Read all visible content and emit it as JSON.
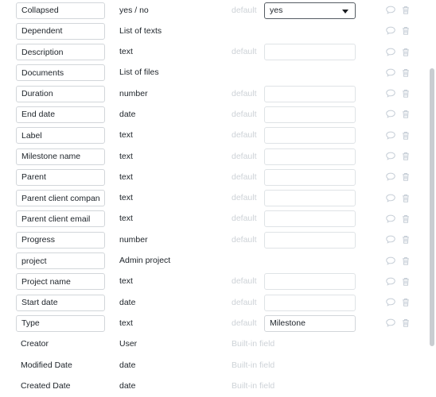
{
  "panel": {
    "default_label": "default",
    "builtin_label": "Built-in field",
    "comment_icon": "comment-icon",
    "delete_icon": "trash-icon",
    "caret_icon": "chevron-down-icon"
  },
  "colors": {
    "text": "#20262c",
    "muted": "#cdd2d7",
    "border": "#d2d6da",
    "border_light": "#dfe3e6",
    "icon": "#c5cdd6",
    "scrollbar": "#c9cdd1"
  },
  "fields": [
    {
      "name": "Collapsed",
      "type": "yes / no",
      "editable": true,
      "default_kind": "select",
      "default_label": "default",
      "default_value": "yes",
      "actions": true
    },
    {
      "name": "Dependent",
      "type": "List of texts",
      "editable": true,
      "default_kind": "none",
      "default_label": "",
      "default_value": "",
      "actions": true
    },
    {
      "name": "Description",
      "type": "text",
      "editable": true,
      "default_kind": "input",
      "default_label": "default",
      "default_value": "",
      "actions": true
    },
    {
      "name": "Documents",
      "type": "List of files",
      "editable": true,
      "default_kind": "none",
      "default_label": "",
      "default_value": "",
      "actions": true
    },
    {
      "name": "Duration",
      "type": "number",
      "editable": true,
      "default_kind": "input",
      "default_label": "default",
      "default_value": "",
      "actions": true
    },
    {
      "name": "End date",
      "type": "date",
      "editable": true,
      "default_kind": "input",
      "default_label": "default",
      "default_value": "",
      "actions": true
    },
    {
      "name": "Label",
      "type": "text",
      "editable": true,
      "default_kind": "input",
      "default_label": "default",
      "default_value": "",
      "actions": true
    },
    {
      "name": "Milestone name",
      "type": "text",
      "editable": true,
      "default_kind": "input",
      "default_label": "default",
      "default_value": "",
      "actions": true
    },
    {
      "name": "Parent",
      "type": "text",
      "editable": true,
      "default_kind": "input",
      "default_label": "default",
      "default_value": "",
      "actions": true
    },
    {
      "name": "Parent client company",
      "type": "text",
      "editable": true,
      "default_kind": "input",
      "default_label": "default",
      "default_value": "",
      "actions": true
    },
    {
      "name": "Parent client email",
      "type": "text",
      "editable": true,
      "default_kind": "input",
      "default_label": "default",
      "default_value": "",
      "actions": true
    },
    {
      "name": "Progress",
      "type": "number",
      "editable": true,
      "default_kind": "input",
      "default_label": "default",
      "default_value": "",
      "actions": true
    },
    {
      "name": "project",
      "type": "Admin project",
      "editable": true,
      "default_kind": "none",
      "default_label": "",
      "default_value": "",
      "actions": true
    },
    {
      "name": "Project name",
      "type": "text",
      "editable": true,
      "default_kind": "input",
      "default_label": "default",
      "default_value": "",
      "actions": true
    },
    {
      "name": "Start date",
      "type": "date",
      "editable": true,
      "default_kind": "input",
      "default_label": "default",
      "default_value": "",
      "actions": true
    },
    {
      "name": "Type",
      "type": "text",
      "editable": true,
      "default_kind": "input",
      "default_label": "default",
      "default_value": "Milestone",
      "actions": true
    },
    {
      "name": "Creator",
      "type": "User",
      "editable": false,
      "default_kind": "builtin",
      "default_label": "Built-in field",
      "default_value": "",
      "actions": false
    },
    {
      "name": "Modified Date",
      "type": "date",
      "editable": false,
      "default_kind": "builtin",
      "default_label": "Built-in field",
      "default_value": "",
      "actions": false
    },
    {
      "name": "Created Date",
      "type": "date",
      "editable": false,
      "default_kind": "builtin",
      "default_label": "Built-in field",
      "default_value": "",
      "actions": false
    }
  ]
}
